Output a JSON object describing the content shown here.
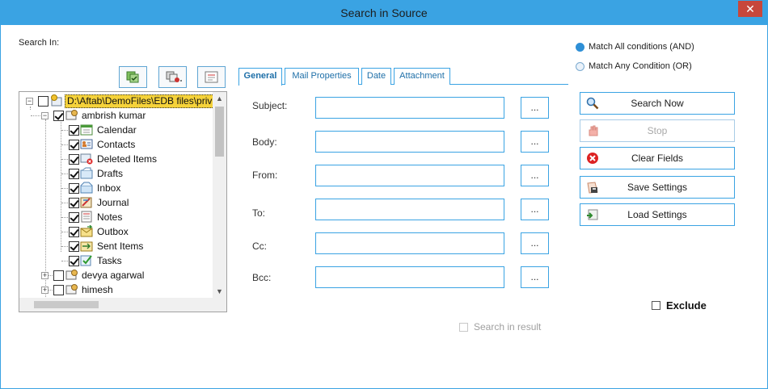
{
  "window": {
    "title": "Search in Source",
    "close_glyph": "✕"
  },
  "search_in": {
    "label": "Search In:"
  },
  "tree": {
    "root": {
      "label": "D:\\Aftab\\DemoFiles\\EDB files\\priv",
      "expander": "−"
    },
    "mailbox": {
      "label": "ambrish kumar",
      "expander": "−"
    },
    "folders": [
      {
        "label": "Calendar",
        "icon": "calendar-icon"
      },
      {
        "label": "Contacts",
        "icon": "contacts-icon"
      },
      {
        "label": "Deleted Items",
        "icon": "deleted-items-icon"
      },
      {
        "label": "Drafts",
        "icon": "drafts-icon"
      },
      {
        "label": "Inbox",
        "icon": "inbox-icon"
      },
      {
        "label": "Journal",
        "icon": "journal-icon"
      },
      {
        "label": "Notes",
        "icon": "notes-icon"
      },
      {
        "label": "Outbox",
        "icon": "outbox-icon"
      },
      {
        "label": "Sent Items",
        "icon": "sent-items-icon"
      },
      {
        "label": "Tasks",
        "icon": "tasks-icon"
      }
    ],
    "others": [
      {
        "label": "devya agarwal",
        "expander": "+"
      },
      {
        "label": "himesh",
        "expander": "+"
      }
    ]
  },
  "tabs": [
    {
      "label": "General",
      "active": true
    },
    {
      "label": "Mail Properties"
    },
    {
      "label": "Date"
    },
    {
      "label": "Attachment"
    }
  ],
  "fields": [
    {
      "label": "Subject:",
      "value": ""
    },
    {
      "label": "Body:",
      "value": ""
    },
    {
      "label": "From:",
      "value": ""
    },
    {
      "label": "To:",
      "value": ""
    },
    {
      "label": "Cc:",
      "value": ""
    },
    {
      "label": "Bcc:",
      "value": ""
    }
  ],
  "browse_label": "...",
  "match": {
    "all": {
      "label": "Match All conditions (AND)",
      "selected": true
    },
    "any": {
      "label": "Match Any Condition (OR)",
      "selected": false
    }
  },
  "actions": {
    "search_now": "Search Now",
    "stop": "Stop",
    "clear_fields": "Clear Fields",
    "save_settings": "Save Settings",
    "load_settings": "Load Settings"
  },
  "exclude": {
    "label": "Exclude",
    "checked": false
  },
  "search_in_result": {
    "label": "Search in result",
    "checked": false,
    "enabled": false
  },
  "colors": {
    "accent": "#3aa3e3",
    "close": "#c7473b",
    "root_highlight": "#f5d23a"
  }
}
